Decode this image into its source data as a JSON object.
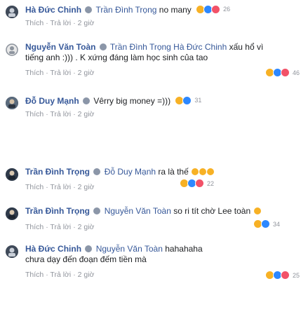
{
  "comments": [
    {
      "author": "Hà Đức Chinh",
      "tag": "Trần Đình Trọng",
      "text": "no many",
      "reactions": "26",
      "like": "Thích",
      "reply": "Trả lời",
      "time": "2 giờ"
    },
    {
      "author": "Nguyễn Văn Toàn",
      "tag": "Trần Đình Trọng Hà Đức Chinh",
      "text": "xấu hổ vì tiếng anh :))) . K xứng đáng làm học sinh của tao",
      "reactions": "46",
      "like": "Thích",
      "reply": "Trả lời",
      "time": "2 giờ"
    },
    {
      "author": "Đỗ Duy Mạnh",
      "tag": "",
      "text": "Vêrry big money =)))",
      "reactions": "31",
      "like": "Thích",
      "reply": "Trả lời",
      "time": "2 giờ"
    },
    {
      "author": "Trần Đình Trọng",
      "tag": "Đỗ Duy Mạnh",
      "text": "ra là thế",
      "reactions": "22",
      "like": "Thích",
      "reply": "Trả lời",
      "time": "2 giờ"
    },
    {
      "author": "Trần Đình Trọng",
      "tag": "Nguyễn Văn Toàn",
      "text": "so ri tít chờ Lee toàn",
      "reactions": "34",
      "like": "Thích",
      "reply": "Trả lời",
      "time": "2 giờ"
    },
    {
      "author": "Hà Đức Chinh",
      "tag": "Nguyễn Văn Toàn",
      "text": "hahahaha chưa dạy đến đoạn đếm tiền mà",
      "reactions": "25",
      "like": "Thích",
      "reply": "Trả lời",
      "time": "2 giờ"
    }
  ]
}
